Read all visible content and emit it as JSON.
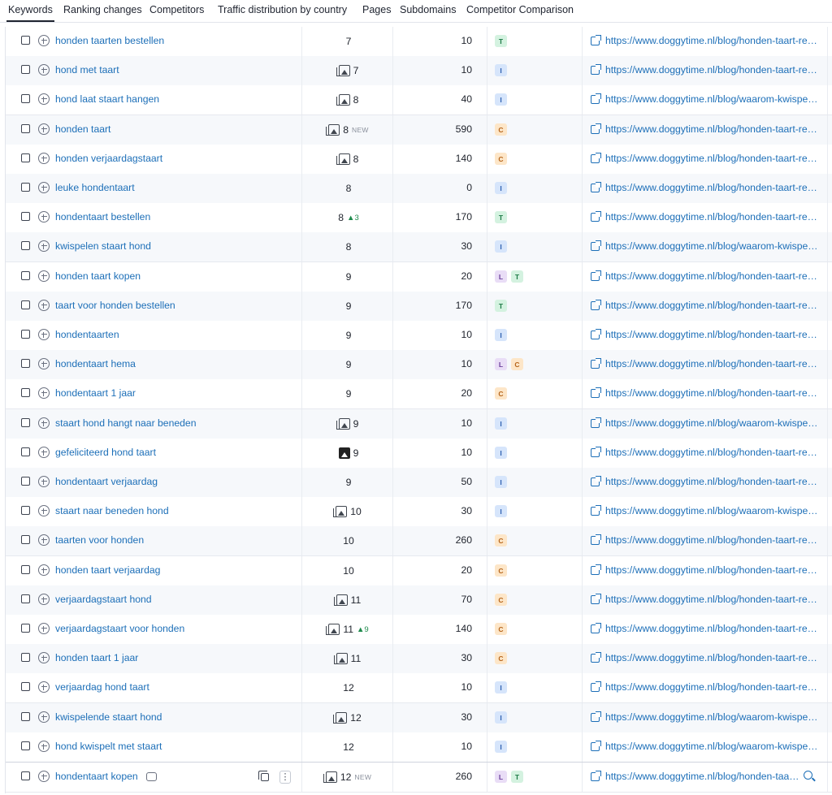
{
  "tabs": [
    "Keywords",
    "Ranking changes",
    "Competitors",
    "Traffic distribution by country",
    "Pages",
    "Subdomains",
    "Competitor Comparison"
  ],
  "active_tab": "Keywords",
  "colors": {
    "link": "#1d6fb8",
    "positive_change": "#1e8a4c",
    "intent_T": "#d4f2e0",
    "intent_I": "#d6e5fb",
    "intent_C": "#fde6c8",
    "intent_L": "#e9ddf6"
  },
  "rows": [
    {
      "keyword": "honden taarten bestellen",
      "position": "7",
      "serp": "",
      "change": "",
      "new": "",
      "volume": "10",
      "intents": [
        "T"
      ],
      "url": "https://www.doggytime.nl/blog/honden-taart-recepten/"
    },
    {
      "keyword": "hond met taart",
      "position": "7",
      "serp": "outline",
      "change": "",
      "new": "",
      "volume": "10",
      "intents": [
        "I"
      ],
      "url": "https://www.doggytime.nl/blog/honden-taart-recepten/"
    },
    {
      "keyword": "hond laat staart hangen",
      "position": "8",
      "serp": "outline",
      "change": "",
      "new": "",
      "volume": "40",
      "intents": [
        "I"
      ],
      "url": "https://www.doggytime.nl/blog/waarom-kwispelt-een-hond/"
    },
    {
      "keyword": "honden taart",
      "position": "8",
      "serp": "outline",
      "change": "",
      "new": "NEW",
      "volume": "590",
      "intents": [
        "C"
      ],
      "url": "https://www.doggytime.nl/blog/honden-taart-recepten/"
    },
    {
      "keyword": "honden verjaardagstaart",
      "position": "8",
      "serp": "outline",
      "change": "",
      "new": "",
      "volume": "140",
      "intents": [
        "C"
      ],
      "url": "https://www.doggytime.nl/blog/honden-taart-recepten/"
    },
    {
      "keyword": "leuke hondentaart",
      "position": "8",
      "serp": "",
      "change": "",
      "new": "",
      "volume": "0",
      "intents": [
        "I"
      ],
      "url": "https://www.doggytime.nl/blog/honden-taart-recepten/"
    },
    {
      "keyword": "hondentaart bestellen",
      "position": "8",
      "serp": "",
      "change": "▲3",
      "new": "",
      "volume": "170",
      "intents": [
        "T"
      ],
      "url": "https://www.doggytime.nl/blog/honden-taart-recepten/"
    },
    {
      "keyword": "kwispelen staart hond",
      "position": "8",
      "serp": "",
      "change": "",
      "new": "",
      "volume": "30",
      "intents": [
        "I"
      ],
      "url": "https://www.doggytime.nl/blog/waarom-kwispelt-een-hond/"
    },
    {
      "keyword": "honden taart kopen",
      "position": "9",
      "serp": "",
      "change": "",
      "new": "",
      "volume": "20",
      "intents": [
        "L",
        "T"
      ],
      "url": "https://www.doggytime.nl/blog/honden-taart-recepten/"
    },
    {
      "keyword": "taart voor honden bestellen",
      "position": "9",
      "serp": "",
      "change": "",
      "new": "",
      "volume": "170",
      "intents": [
        "T"
      ],
      "url": "https://www.doggytime.nl/blog/honden-taart-recepten/"
    },
    {
      "keyword": "hondentaarten",
      "position": "9",
      "serp": "",
      "change": "",
      "new": "",
      "volume": "10",
      "intents": [
        "I"
      ],
      "url": "https://www.doggytime.nl/blog/honden-taart-recepten/"
    },
    {
      "keyword": "hondentaart hema",
      "position": "9",
      "serp": "",
      "change": "",
      "new": "",
      "volume": "10",
      "intents": [
        "L",
        "C"
      ],
      "url": "https://www.doggytime.nl/blog/honden-taart-recepten/"
    },
    {
      "keyword": "hondentaart 1 jaar",
      "position": "9",
      "serp": "",
      "change": "",
      "new": "",
      "volume": "20",
      "intents": [
        "C"
      ],
      "url": "https://www.doggytime.nl/blog/honden-taart-recepten/"
    },
    {
      "keyword": "staart hond hangt naar beneden",
      "position": "9",
      "serp": "outline",
      "change": "",
      "new": "",
      "volume": "10",
      "intents": [
        "I"
      ],
      "url": "https://www.doggytime.nl/blog/waarom-kwispelt-een-hond/"
    },
    {
      "keyword": "gefeliciteerd hond taart",
      "position": "9",
      "serp": "filled",
      "change": "",
      "new": "",
      "volume": "10",
      "intents": [
        "I"
      ],
      "url": "https://www.doggytime.nl/blog/honden-taart-recepten/"
    },
    {
      "keyword": "hondentaart verjaardag",
      "position": "9",
      "serp": "",
      "change": "",
      "new": "",
      "volume": "50",
      "intents": [
        "I"
      ],
      "url": "https://www.doggytime.nl/blog/honden-taart-recepten/"
    },
    {
      "keyword": "staart naar beneden hond",
      "position": "10",
      "serp": "outline",
      "change": "",
      "new": "",
      "volume": "30",
      "intents": [
        "I"
      ],
      "url": "https://www.doggytime.nl/blog/waarom-kwispelt-een-hond/"
    },
    {
      "keyword": "taarten voor honden",
      "position": "10",
      "serp": "",
      "change": "",
      "new": "",
      "volume": "260",
      "intents": [
        "C"
      ],
      "url": "https://www.doggytime.nl/blog/honden-taart-recepten/"
    },
    {
      "keyword": "honden taart verjaardag",
      "position": "10",
      "serp": "",
      "change": "",
      "new": "",
      "volume": "20",
      "intents": [
        "C"
      ],
      "url": "https://www.doggytime.nl/blog/honden-taart-recepten/"
    },
    {
      "keyword": "verjaardagstaart hond",
      "position": "11",
      "serp": "outline",
      "change": "",
      "new": "",
      "volume": "70",
      "intents": [
        "C"
      ],
      "url": "https://www.doggytime.nl/blog/honden-taart-recepten/"
    },
    {
      "keyword": "verjaardagstaart voor honden",
      "position": "11",
      "serp": "outline",
      "change": "▲9",
      "new": "",
      "volume": "140",
      "intents": [
        "C"
      ],
      "url": "https://www.doggytime.nl/blog/honden-taart-recepten/"
    },
    {
      "keyword": "honden taart 1 jaar",
      "position": "11",
      "serp": "outline",
      "change": "",
      "new": "",
      "volume": "30",
      "intents": [
        "C"
      ],
      "url": "https://www.doggytime.nl/blog/honden-taart-recepten/"
    },
    {
      "keyword": "verjaardag hond taart",
      "position": "12",
      "serp": "",
      "change": "",
      "new": "",
      "volume": "10",
      "intents": [
        "I"
      ],
      "url": "https://www.doggytime.nl/blog/honden-taart-recepten/"
    },
    {
      "keyword": "kwispelende staart hond",
      "position": "12",
      "serp": "outline",
      "change": "",
      "new": "",
      "volume": "30",
      "intents": [
        "I"
      ],
      "url": "https://www.doggytime.nl/blog/waarom-kwispelt-een-hond/"
    },
    {
      "keyword": "hond kwispelt met staart",
      "position": "12",
      "serp": "",
      "change": "",
      "new": "",
      "volume": "10",
      "intents": [
        "I"
      ],
      "url": "https://www.doggytime.nl/blog/waarom-kwispelt-een-hond/"
    },
    {
      "keyword": "hondentaart kopen",
      "position": "12",
      "serp": "outline",
      "change": "",
      "new": "NEW",
      "volume": "260",
      "intents": [
        "L",
        "T"
      ],
      "url": "https://www.doggytime.nl/blog/honden-taart-recepten/",
      "hovered": true
    }
  ]
}
